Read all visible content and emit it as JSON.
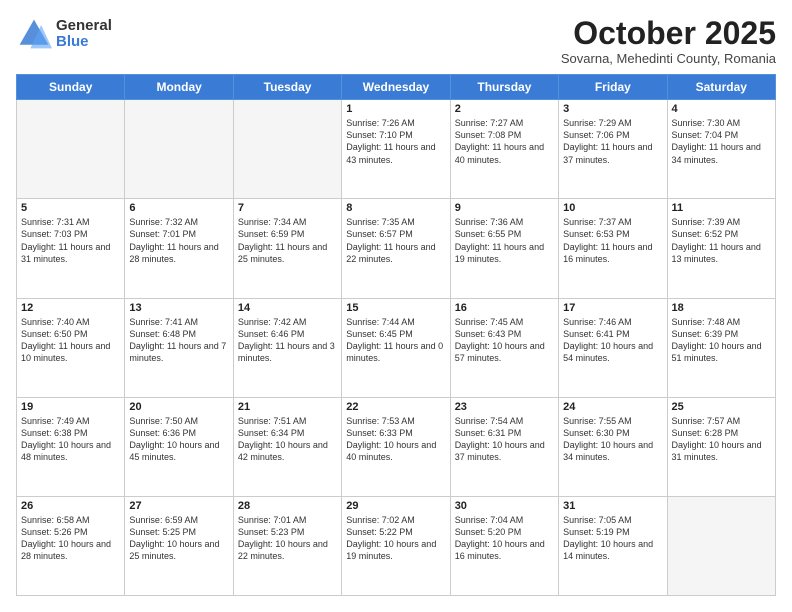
{
  "logo": {
    "general": "General",
    "blue": "Blue"
  },
  "header": {
    "month": "October 2025",
    "location": "Sovarna, Mehedinti County, Romania"
  },
  "weekdays": [
    "Sunday",
    "Monday",
    "Tuesday",
    "Wednesday",
    "Thursday",
    "Friday",
    "Saturday"
  ],
  "weeks": [
    [
      {
        "day": "",
        "empty": true
      },
      {
        "day": "",
        "empty": true
      },
      {
        "day": "",
        "empty": true
      },
      {
        "day": "1",
        "sunrise": "7:26 AM",
        "sunset": "7:10 PM",
        "daylight": "11 hours and 43 minutes."
      },
      {
        "day": "2",
        "sunrise": "7:27 AM",
        "sunset": "7:08 PM",
        "daylight": "11 hours and 40 minutes."
      },
      {
        "day": "3",
        "sunrise": "7:29 AM",
        "sunset": "7:06 PM",
        "daylight": "11 hours and 37 minutes."
      },
      {
        "day": "4",
        "sunrise": "7:30 AM",
        "sunset": "7:04 PM",
        "daylight": "11 hours and 34 minutes."
      }
    ],
    [
      {
        "day": "5",
        "sunrise": "7:31 AM",
        "sunset": "7:03 PM",
        "daylight": "11 hours and 31 minutes."
      },
      {
        "day": "6",
        "sunrise": "7:32 AM",
        "sunset": "7:01 PM",
        "daylight": "11 hours and 28 minutes."
      },
      {
        "day": "7",
        "sunrise": "7:34 AM",
        "sunset": "6:59 PM",
        "daylight": "11 hours and 25 minutes."
      },
      {
        "day": "8",
        "sunrise": "7:35 AM",
        "sunset": "6:57 PM",
        "daylight": "11 hours and 22 minutes."
      },
      {
        "day": "9",
        "sunrise": "7:36 AM",
        "sunset": "6:55 PM",
        "daylight": "11 hours and 19 minutes."
      },
      {
        "day": "10",
        "sunrise": "7:37 AM",
        "sunset": "6:53 PM",
        "daylight": "11 hours and 16 minutes."
      },
      {
        "day": "11",
        "sunrise": "7:39 AM",
        "sunset": "6:52 PM",
        "daylight": "11 hours and 13 minutes."
      }
    ],
    [
      {
        "day": "12",
        "sunrise": "7:40 AM",
        "sunset": "6:50 PM",
        "daylight": "11 hours and 10 minutes."
      },
      {
        "day": "13",
        "sunrise": "7:41 AM",
        "sunset": "6:48 PM",
        "daylight": "11 hours and 7 minutes."
      },
      {
        "day": "14",
        "sunrise": "7:42 AM",
        "sunset": "6:46 PM",
        "daylight": "11 hours and 3 minutes."
      },
      {
        "day": "15",
        "sunrise": "7:44 AM",
        "sunset": "6:45 PM",
        "daylight": "11 hours and 0 minutes."
      },
      {
        "day": "16",
        "sunrise": "7:45 AM",
        "sunset": "6:43 PM",
        "daylight": "10 hours and 57 minutes."
      },
      {
        "day": "17",
        "sunrise": "7:46 AM",
        "sunset": "6:41 PM",
        "daylight": "10 hours and 54 minutes."
      },
      {
        "day": "18",
        "sunrise": "7:48 AM",
        "sunset": "6:39 PM",
        "daylight": "10 hours and 51 minutes."
      }
    ],
    [
      {
        "day": "19",
        "sunrise": "7:49 AM",
        "sunset": "6:38 PM",
        "daylight": "10 hours and 48 minutes."
      },
      {
        "day": "20",
        "sunrise": "7:50 AM",
        "sunset": "6:36 PM",
        "daylight": "10 hours and 45 minutes."
      },
      {
        "day": "21",
        "sunrise": "7:51 AM",
        "sunset": "6:34 PM",
        "daylight": "10 hours and 42 minutes."
      },
      {
        "day": "22",
        "sunrise": "7:53 AM",
        "sunset": "6:33 PM",
        "daylight": "10 hours and 40 minutes."
      },
      {
        "day": "23",
        "sunrise": "7:54 AM",
        "sunset": "6:31 PM",
        "daylight": "10 hours and 37 minutes."
      },
      {
        "day": "24",
        "sunrise": "7:55 AM",
        "sunset": "6:30 PM",
        "daylight": "10 hours and 34 minutes."
      },
      {
        "day": "25",
        "sunrise": "7:57 AM",
        "sunset": "6:28 PM",
        "daylight": "10 hours and 31 minutes."
      }
    ],
    [
      {
        "day": "26",
        "sunrise": "6:58 AM",
        "sunset": "5:26 PM",
        "daylight": "10 hours and 28 minutes."
      },
      {
        "day": "27",
        "sunrise": "6:59 AM",
        "sunset": "5:25 PM",
        "daylight": "10 hours and 25 minutes."
      },
      {
        "day": "28",
        "sunrise": "7:01 AM",
        "sunset": "5:23 PM",
        "daylight": "10 hours and 22 minutes."
      },
      {
        "day": "29",
        "sunrise": "7:02 AM",
        "sunset": "5:22 PM",
        "daylight": "10 hours and 19 minutes."
      },
      {
        "day": "30",
        "sunrise": "7:04 AM",
        "sunset": "5:20 PM",
        "daylight": "10 hours and 16 minutes."
      },
      {
        "day": "31",
        "sunrise": "7:05 AM",
        "sunset": "5:19 PM",
        "daylight": "10 hours and 14 minutes."
      },
      {
        "day": "",
        "empty": true
      }
    ]
  ]
}
